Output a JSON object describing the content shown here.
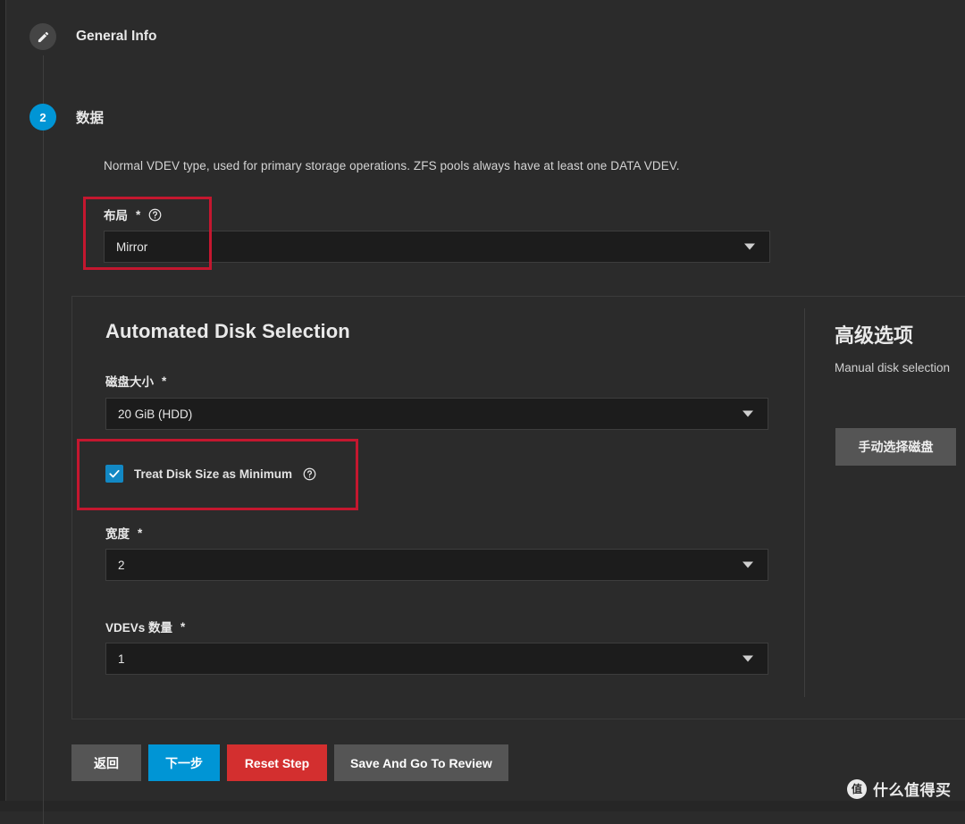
{
  "theme": {
    "background": "#2b2b2b",
    "accent": "#0095d5",
    "danger": "#d32f2f",
    "annotation": "#c4172f",
    "checkbox": "#1288c4",
    "field_background": "#1c1c1c"
  },
  "stepper": {
    "steps": [
      {
        "badge": "",
        "icon": "pencil-icon",
        "label": "General Info",
        "state": "done"
      },
      {
        "badge": "2",
        "icon": "",
        "label": "数据",
        "state": "active"
      }
    ]
  },
  "main": {
    "description": "Normal VDEV type, used for primary storage operations. ZFS pools always have at least one DATA VDEV.",
    "layout_field": {
      "label": "布局",
      "required_mark": "*",
      "help_icon": "help-circle-icon",
      "value": "Mirror"
    },
    "card": {
      "title": "Automated Disk Selection",
      "disk_size": {
        "label": "磁盘大小",
        "required_mark": "*",
        "value": "20 GiB (HDD)"
      },
      "treat_min": {
        "label": "Treat Disk Size as Minimum",
        "checked": true,
        "check_glyph": "✓",
        "help_icon": "help-circle-icon"
      },
      "width": {
        "label": "宽度",
        "required_mark": "*",
        "value": "2"
      },
      "vdevs": {
        "label": "VDEVs 数量",
        "required_mark": "*",
        "value": "1"
      }
    },
    "advanced": {
      "title": "高级选项",
      "description": "Manual disk selection",
      "button_label": "手动选择磁盘"
    }
  },
  "actions": {
    "back": "返回",
    "next": "下一步",
    "reset": "Reset Step",
    "save": "Save And Go To Review"
  },
  "watermark": {
    "logo": "值",
    "text": "什么值得买"
  }
}
